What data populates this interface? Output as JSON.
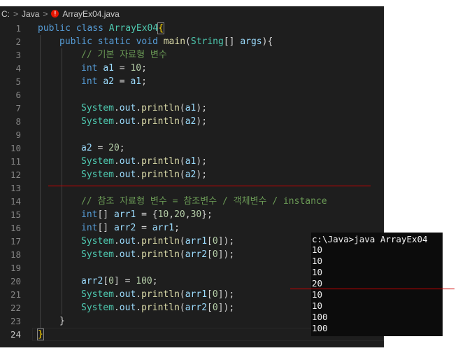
{
  "breadcrumb": {
    "items": [
      "C:",
      "Java",
      "ArrayEx04.java"
    ],
    "separator": ">",
    "error_badge": "!"
  },
  "editor": {
    "active_line": 24,
    "lines": [
      {
        "n": "1",
        "indent": 0,
        "tokens": [
          [
            "kw",
            "public"
          ],
          [
            "p",
            " "
          ],
          [
            "kw",
            "class"
          ],
          [
            "p",
            " "
          ],
          [
            "cls",
            "ArrayEx04"
          ],
          [
            "br",
            "{"
          ]
        ]
      },
      {
        "n": "2",
        "indent": 1,
        "tokens": [
          [
            "kw",
            "public"
          ],
          [
            "p",
            " "
          ],
          [
            "kw",
            "static"
          ],
          [
            "p",
            " "
          ],
          [
            "kw",
            "void"
          ],
          [
            "p",
            " "
          ],
          [
            "fn",
            "main"
          ],
          [
            "p",
            "("
          ],
          [
            "cls",
            "String"
          ],
          [
            "p",
            "[] "
          ],
          [
            "var",
            "args"
          ],
          [
            "p",
            "){"
          ]
        ]
      },
      {
        "n": "3",
        "indent": 2,
        "tokens": [
          [
            "cm",
            "// 기본 자료형 변수"
          ]
        ]
      },
      {
        "n": "4",
        "indent": 2,
        "tokens": [
          [
            "kw",
            "int"
          ],
          [
            "p",
            " "
          ],
          [
            "var",
            "a1"
          ],
          [
            "p",
            " = "
          ],
          [
            "num",
            "10"
          ],
          [
            "p",
            ";"
          ]
        ]
      },
      {
        "n": "5",
        "indent": 2,
        "tokens": [
          [
            "kw",
            "int"
          ],
          [
            "p",
            " "
          ],
          [
            "var",
            "a2"
          ],
          [
            "p",
            " = "
          ],
          [
            "var",
            "a1"
          ],
          [
            "p",
            ";"
          ]
        ]
      },
      {
        "n": "6",
        "indent": 0,
        "tokens": []
      },
      {
        "n": "7",
        "indent": 2,
        "tokens": [
          [
            "cls",
            "System"
          ],
          [
            "p",
            "."
          ],
          [
            "var",
            "out"
          ],
          [
            "p",
            "."
          ],
          [
            "fn",
            "println"
          ],
          [
            "p",
            "("
          ],
          [
            "var",
            "a1"
          ],
          [
            "p",
            ");"
          ]
        ]
      },
      {
        "n": "8",
        "indent": 2,
        "tokens": [
          [
            "cls",
            "System"
          ],
          [
            "p",
            "."
          ],
          [
            "var",
            "out"
          ],
          [
            "p",
            "."
          ],
          [
            "fn",
            "println"
          ],
          [
            "p",
            "("
          ],
          [
            "var",
            "a2"
          ],
          [
            "p",
            ");"
          ]
        ]
      },
      {
        "n": "9",
        "indent": 0,
        "tokens": []
      },
      {
        "n": "10",
        "indent": 2,
        "tokens": [
          [
            "var",
            "a2"
          ],
          [
            "p",
            " = "
          ],
          [
            "num",
            "20"
          ],
          [
            "p",
            ";"
          ]
        ]
      },
      {
        "n": "11",
        "indent": 2,
        "tokens": [
          [
            "cls",
            "System"
          ],
          [
            "p",
            "."
          ],
          [
            "var",
            "out"
          ],
          [
            "p",
            "."
          ],
          [
            "fn",
            "println"
          ],
          [
            "p",
            "("
          ],
          [
            "var",
            "a1"
          ],
          [
            "p",
            ");"
          ]
        ]
      },
      {
        "n": "12",
        "indent": 2,
        "tokens": [
          [
            "cls",
            "System"
          ],
          [
            "p",
            "."
          ],
          [
            "var",
            "out"
          ],
          [
            "p",
            "."
          ],
          [
            "fn",
            "println"
          ],
          [
            "p",
            "("
          ],
          [
            "var",
            "a2"
          ],
          [
            "p",
            ");"
          ]
        ]
      },
      {
        "n": "13",
        "indent": 0,
        "tokens": []
      },
      {
        "n": "14",
        "indent": 2,
        "tokens": [
          [
            "cm",
            "// 참조 자료형 변수 = 참조변수 / 객체변수 / instance"
          ]
        ]
      },
      {
        "n": "15",
        "indent": 2,
        "tokens": [
          [
            "kw",
            "int"
          ],
          [
            "p",
            "[] "
          ],
          [
            "var",
            "arr1"
          ],
          [
            "p",
            " = {"
          ],
          [
            "num",
            "10"
          ],
          [
            "p",
            ","
          ],
          [
            "num",
            "20"
          ],
          [
            "p",
            ","
          ],
          [
            "num",
            "30"
          ],
          [
            "p",
            "};"
          ]
        ]
      },
      {
        "n": "16",
        "indent": 2,
        "tokens": [
          [
            "kw",
            "int"
          ],
          [
            "p",
            "[] "
          ],
          [
            "var",
            "arr2"
          ],
          [
            "p",
            " = "
          ],
          [
            "var",
            "arr1"
          ],
          [
            "p",
            ";"
          ]
        ]
      },
      {
        "n": "17",
        "indent": 2,
        "tokens": [
          [
            "cls",
            "System"
          ],
          [
            "p",
            "."
          ],
          [
            "var",
            "out"
          ],
          [
            "p",
            "."
          ],
          [
            "fn",
            "println"
          ],
          [
            "p",
            "("
          ],
          [
            "var",
            "arr1"
          ],
          [
            "p",
            "["
          ],
          [
            "num",
            "0"
          ],
          [
            "p",
            "]);"
          ]
        ]
      },
      {
        "n": "18",
        "indent": 2,
        "tokens": [
          [
            "cls",
            "System"
          ],
          [
            "p",
            "."
          ],
          [
            "var",
            "out"
          ],
          [
            "p",
            "."
          ],
          [
            "fn",
            "println"
          ],
          [
            "p",
            "("
          ],
          [
            "var",
            "arr2"
          ],
          [
            "p",
            "["
          ],
          [
            "num",
            "0"
          ],
          [
            "p",
            "]);"
          ]
        ]
      },
      {
        "n": "19",
        "indent": 0,
        "tokens": []
      },
      {
        "n": "20",
        "indent": 2,
        "tokens": [
          [
            "var",
            "arr2"
          ],
          [
            "p",
            "["
          ],
          [
            "num",
            "0"
          ],
          [
            "p",
            "] = "
          ],
          [
            "num",
            "100"
          ],
          [
            "p",
            ";"
          ]
        ]
      },
      {
        "n": "21",
        "indent": 2,
        "tokens": [
          [
            "cls",
            "System"
          ],
          [
            "p",
            "."
          ],
          [
            "var",
            "out"
          ],
          [
            "p",
            "."
          ],
          [
            "fn",
            "println"
          ],
          [
            "p",
            "("
          ],
          [
            "var",
            "arr1"
          ],
          [
            "p",
            "["
          ],
          [
            "num",
            "0"
          ],
          [
            "p",
            "]);"
          ]
        ]
      },
      {
        "n": "22",
        "indent": 2,
        "tokens": [
          [
            "cls",
            "System"
          ],
          [
            "p",
            "."
          ],
          [
            "var",
            "out"
          ],
          [
            "p",
            "."
          ],
          [
            "fn",
            "println"
          ],
          [
            "p",
            "("
          ],
          [
            "var",
            "arr2"
          ],
          [
            "p",
            "["
          ],
          [
            "num",
            "0"
          ],
          [
            "p",
            "]);"
          ]
        ]
      },
      {
        "n": "23",
        "indent": 1,
        "tokens": [
          [
            "p",
            "}"
          ]
        ]
      },
      {
        "n": "24",
        "indent": 0,
        "tokens": [
          [
            "br",
            "}"
          ]
        ]
      }
    ]
  },
  "terminal": {
    "lines": [
      "c:\\Java>java ArrayEx04",
      "10",
      "10",
      "10",
      "20",
      "10",
      "10",
      "100",
      "100"
    ]
  },
  "colors": {
    "kw": "#569cd6",
    "cls": "#4ec9b0",
    "fn": "#dcdcaa",
    "var": "#9cdcfe",
    "num": "#b5cea8",
    "cm": "#6a9955",
    "p": "#d4d4d4",
    "br": "#ffd700",
    "annotation": "#d10000"
  }
}
